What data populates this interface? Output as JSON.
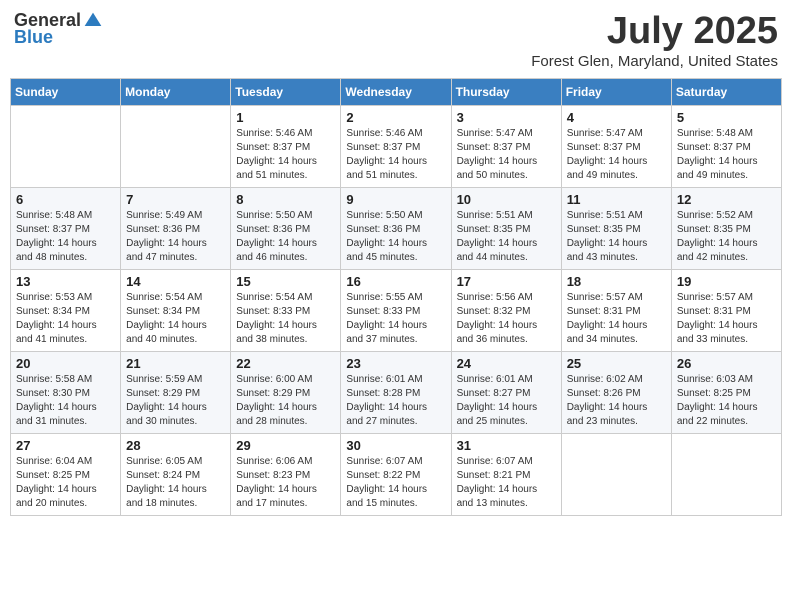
{
  "header": {
    "logo_general": "General",
    "logo_blue": "Blue",
    "title": "July 2025",
    "location": "Forest Glen, Maryland, United States"
  },
  "days_of_week": [
    "Sunday",
    "Monday",
    "Tuesday",
    "Wednesday",
    "Thursday",
    "Friday",
    "Saturday"
  ],
  "weeks": [
    [
      {
        "day": "",
        "sunrise": "",
        "sunset": "",
        "daylight": ""
      },
      {
        "day": "",
        "sunrise": "",
        "sunset": "",
        "daylight": ""
      },
      {
        "day": "1",
        "sunrise": "Sunrise: 5:46 AM",
        "sunset": "Sunset: 8:37 PM",
        "daylight": "Daylight: 14 hours and 51 minutes."
      },
      {
        "day": "2",
        "sunrise": "Sunrise: 5:46 AM",
        "sunset": "Sunset: 8:37 PM",
        "daylight": "Daylight: 14 hours and 51 minutes."
      },
      {
        "day": "3",
        "sunrise": "Sunrise: 5:47 AM",
        "sunset": "Sunset: 8:37 PM",
        "daylight": "Daylight: 14 hours and 50 minutes."
      },
      {
        "day": "4",
        "sunrise": "Sunrise: 5:47 AM",
        "sunset": "Sunset: 8:37 PM",
        "daylight": "Daylight: 14 hours and 49 minutes."
      },
      {
        "day": "5",
        "sunrise": "Sunrise: 5:48 AM",
        "sunset": "Sunset: 8:37 PM",
        "daylight": "Daylight: 14 hours and 49 minutes."
      }
    ],
    [
      {
        "day": "6",
        "sunrise": "Sunrise: 5:48 AM",
        "sunset": "Sunset: 8:37 PM",
        "daylight": "Daylight: 14 hours and 48 minutes."
      },
      {
        "day": "7",
        "sunrise": "Sunrise: 5:49 AM",
        "sunset": "Sunset: 8:36 PM",
        "daylight": "Daylight: 14 hours and 47 minutes."
      },
      {
        "day": "8",
        "sunrise": "Sunrise: 5:50 AM",
        "sunset": "Sunset: 8:36 PM",
        "daylight": "Daylight: 14 hours and 46 minutes."
      },
      {
        "day": "9",
        "sunrise": "Sunrise: 5:50 AM",
        "sunset": "Sunset: 8:36 PM",
        "daylight": "Daylight: 14 hours and 45 minutes."
      },
      {
        "day": "10",
        "sunrise": "Sunrise: 5:51 AM",
        "sunset": "Sunset: 8:35 PM",
        "daylight": "Daylight: 14 hours and 44 minutes."
      },
      {
        "day": "11",
        "sunrise": "Sunrise: 5:51 AM",
        "sunset": "Sunset: 8:35 PM",
        "daylight": "Daylight: 14 hours and 43 minutes."
      },
      {
        "day": "12",
        "sunrise": "Sunrise: 5:52 AM",
        "sunset": "Sunset: 8:35 PM",
        "daylight": "Daylight: 14 hours and 42 minutes."
      }
    ],
    [
      {
        "day": "13",
        "sunrise": "Sunrise: 5:53 AM",
        "sunset": "Sunset: 8:34 PM",
        "daylight": "Daylight: 14 hours and 41 minutes."
      },
      {
        "day": "14",
        "sunrise": "Sunrise: 5:54 AM",
        "sunset": "Sunset: 8:34 PM",
        "daylight": "Daylight: 14 hours and 40 minutes."
      },
      {
        "day": "15",
        "sunrise": "Sunrise: 5:54 AM",
        "sunset": "Sunset: 8:33 PM",
        "daylight": "Daylight: 14 hours and 38 minutes."
      },
      {
        "day": "16",
        "sunrise": "Sunrise: 5:55 AM",
        "sunset": "Sunset: 8:33 PM",
        "daylight": "Daylight: 14 hours and 37 minutes."
      },
      {
        "day": "17",
        "sunrise": "Sunrise: 5:56 AM",
        "sunset": "Sunset: 8:32 PM",
        "daylight": "Daylight: 14 hours and 36 minutes."
      },
      {
        "day": "18",
        "sunrise": "Sunrise: 5:57 AM",
        "sunset": "Sunset: 8:31 PM",
        "daylight": "Daylight: 14 hours and 34 minutes."
      },
      {
        "day": "19",
        "sunrise": "Sunrise: 5:57 AM",
        "sunset": "Sunset: 8:31 PM",
        "daylight": "Daylight: 14 hours and 33 minutes."
      }
    ],
    [
      {
        "day": "20",
        "sunrise": "Sunrise: 5:58 AM",
        "sunset": "Sunset: 8:30 PM",
        "daylight": "Daylight: 14 hours and 31 minutes."
      },
      {
        "day": "21",
        "sunrise": "Sunrise: 5:59 AM",
        "sunset": "Sunset: 8:29 PM",
        "daylight": "Daylight: 14 hours and 30 minutes."
      },
      {
        "day": "22",
        "sunrise": "Sunrise: 6:00 AM",
        "sunset": "Sunset: 8:29 PM",
        "daylight": "Daylight: 14 hours and 28 minutes."
      },
      {
        "day": "23",
        "sunrise": "Sunrise: 6:01 AM",
        "sunset": "Sunset: 8:28 PM",
        "daylight": "Daylight: 14 hours and 27 minutes."
      },
      {
        "day": "24",
        "sunrise": "Sunrise: 6:01 AM",
        "sunset": "Sunset: 8:27 PM",
        "daylight": "Daylight: 14 hours and 25 minutes."
      },
      {
        "day": "25",
        "sunrise": "Sunrise: 6:02 AM",
        "sunset": "Sunset: 8:26 PM",
        "daylight": "Daylight: 14 hours and 23 minutes."
      },
      {
        "day": "26",
        "sunrise": "Sunrise: 6:03 AM",
        "sunset": "Sunset: 8:25 PM",
        "daylight": "Daylight: 14 hours and 22 minutes."
      }
    ],
    [
      {
        "day": "27",
        "sunrise": "Sunrise: 6:04 AM",
        "sunset": "Sunset: 8:25 PM",
        "daylight": "Daylight: 14 hours and 20 minutes."
      },
      {
        "day": "28",
        "sunrise": "Sunrise: 6:05 AM",
        "sunset": "Sunset: 8:24 PM",
        "daylight": "Daylight: 14 hours and 18 minutes."
      },
      {
        "day": "29",
        "sunrise": "Sunrise: 6:06 AM",
        "sunset": "Sunset: 8:23 PM",
        "daylight": "Daylight: 14 hours and 17 minutes."
      },
      {
        "day": "30",
        "sunrise": "Sunrise: 6:07 AM",
        "sunset": "Sunset: 8:22 PM",
        "daylight": "Daylight: 14 hours and 15 minutes."
      },
      {
        "day": "31",
        "sunrise": "Sunrise: 6:07 AM",
        "sunset": "Sunset: 8:21 PM",
        "daylight": "Daylight: 14 hours and 13 minutes."
      },
      {
        "day": "",
        "sunrise": "",
        "sunset": "",
        "daylight": ""
      },
      {
        "day": "",
        "sunrise": "",
        "sunset": "",
        "daylight": ""
      }
    ]
  ]
}
